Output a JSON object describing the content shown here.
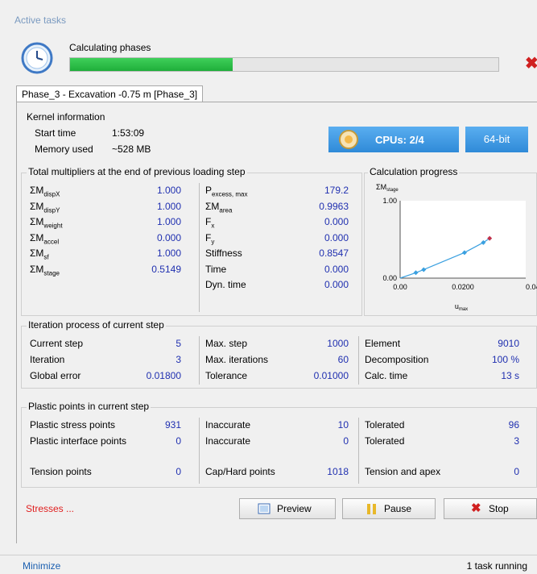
{
  "window_title": "Active tasks",
  "calc": {
    "label": "Calculating phases",
    "progress_pct": 38
  },
  "phase_tab": "Phase_3 - Excavation -0.75 m [Phase_3]",
  "kernel": {
    "title": "Kernel information",
    "start_time_label": "Start time",
    "start_time_value": "1:53:09",
    "memory_label": "Memory used",
    "memory_value": "~528 MB",
    "cpus": "CPUs: 2/4",
    "bits": "64-bit"
  },
  "multipliers": {
    "title": "Total multipliers at the end of previous loading step",
    "left": [
      {
        "sym": "ΣM",
        "sub": "dispX",
        "value": "1.000"
      },
      {
        "sym": "ΣM",
        "sub": "dispY",
        "value": "1.000"
      },
      {
        "sym": "ΣM",
        "sub": "weight",
        "value": "1.000"
      },
      {
        "sym": "ΣM",
        "sub": "accel",
        "value": "0.000"
      },
      {
        "sym": "ΣM",
        "sub": "sf",
        "value": "1.000"
      },
      {
        "sym": "ΣM",
        "sub": "stage",
        "value": "0.5149"
      }
    ],
    "right": [
      {
        "sym": "P",
        "sub": "excess, max",
        "value": "179.2"
      },
      {
        "sym": "ΣM",
        "sub": "area",
        "value": "0.9963"
      },
      {
        "sym": "F",
        "sub": "x",
        "value": "0.000"
      },
      {
        "sym": "F",
        "sub": "y",
        "value": "0.000"
      },
      {
        "sym": "Stiffness",
        "sub": "",
        "value": "0.8547"
      },
      {
        "sym": "Time",
        "sub": "",
        "value": "0.000"
      },
      {
        "sym": "Dyn. time",
        "sub": "",
        "value": "0.000"
      }
    ]
  },
  "chart_data": {
    "type": "line",
    "title": "Calculation progress",
    "ylabel": "ΣM",
    "ylabel_sub": "stage",
    "xlabel": "u",
    "xlabel_sub": "max",
    "x_ticks": [
      "0.00",
      "0.0200",
      "0.04"
    ],
    "y_ticks": [
      "0.00",
      "1.00"
    ],
    "xlim": [
      0,
      0.04
    ],
    "ylim": [
      0,
      1
    ],
    "series": [
      {
        "x": [
          0.0,
          0.005,
          0.0075,
          0.0205,
          0.0265,
          0.0285
        ],
        "y": [
          0.0,
          0.07,
          0.11,
          0.33,
          0.46,
          0.5149
        ]
      }
    ],
    "colors": {
      "line": "#3aa0e0",
      "first": "#4caf50",
      "last": "#c0304a"
    }
  },
  "iteration": {
    "title": "Iteration process of current step",
    "col1": [
      {
        "label": "Current step",
        "value": "5"
      },
      {
        "label": "Iteration",
        "value": "3"
      },
      {
        "label": "Global error",
        "value": "0.01800"
      }
    ],
    "col2": [
      {
        "label": "Max. step",
        "value": "1000"
      },
      {
        "label": "Max. iterations",
        "value": "60"
      },
      {
        "label": "Tolerance",
        "value": "0.01000"
      }
    ],
    "col3": [
      {
        "label": "Element",
        "value": "9010"
      },
      {
        "label": "Decomposition",
        "value": "100 %"
      },
      {
        "label": "Calc. time",
        "value": "13 s"
      }
    ]
  },
  "plastic": {
    "title": "Plastic points in current step",
    "col1": [
      {
        "label": "Plastic stress points",
        "value": "931"
      },
      {
        "label": "Plastic interface points",
        "value": "0"
      },
      {
        "label": "Tension points",
        "value": "0"
      }
    ],
    "col2": [
      {
        "label": "Inaccurate",
        "value": "10"
      },
      {
        "label": "Inaccurate",
        "value": "0"
      },
      {
        "label": "Cap/Hard points",
        "value": "1018"
      }
    ],
    "col3": [
      {
        "label": "Tolerated",
        "value": "96"
      },
      {
        "label": "Tolerated",
        "value": "3"
      },
      {
        "label": "Tension and apex",
        "value": "0"
      }
    ]
  },
  "footer": {
    "stresses_link": "Stresses ...",
    "preview_label": "Preview",
    "pause_label": "Pause",
    "stop_label": "Stop"
  },
  "status": {
    "minimize": "Minimize",
    "tasks": "1 task running"
  }
}
